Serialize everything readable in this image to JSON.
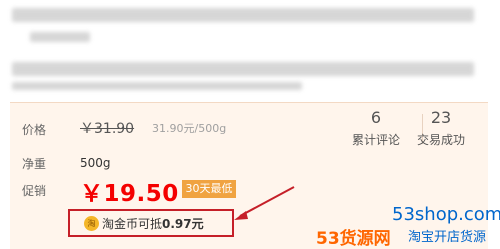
{
  "product": {
    "price_label": "价格",
    "original_price": "￥31.90",
    "unit_price": "31.90元/500g",
    "weight_label": "净重",
    "weight_value": "500g",
    "promo_label": "促销",
    "promo_price": "￥19.50",
    "promo_badge": "30天最低"
  },
  "stats": {
    "reviews_count": "6",
    "reviews_label": "累计评论",
    "sales_count": "23",
    "sales_label": "交易成功"
  },
  "coupon": {
    "icon_text": "淘",
    "text_prefix": "淘金币可抵",
    "amount": "0.97元"
  },
  "watermark": {
    "site": "53shop.com",
    "brand": "53货源网",
    "slogan": "淘宝开店货源"
  },
  "colors": {
    "accent_red": "#f40000",
    "badge_orange": "#f0a341",
    "arrow_red": "#c51f28"
  }
}
